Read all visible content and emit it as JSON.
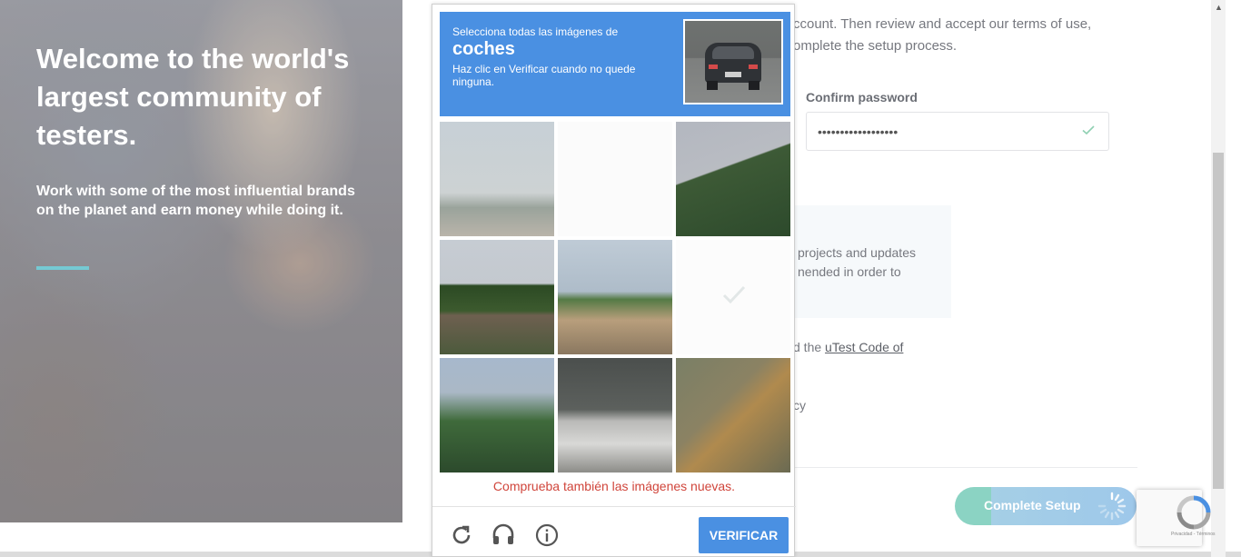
{
  "hero": {
    "title": "Welcome to the world's largest community of testers.",
    "subtitle": "Work with some of the most influential brands on the planet and earn money while doing it."
  },
  "form": {
    "intro_line1": "ccount. Then review and accept our terms of use,",
    "intro_line2": "omplete the setup process.",
    "confirm_password_label": "Confirm password",
    "confirm_password_value": "••••••••••••••••••",
    "info_line1": "projects and updates",
    "info_line2": "nended in order to",
    "terms_prefix": "d the ",
    "terms_link": "uTest Code of",
    "policy_fragment": "cy",
    "complete_setup_label": "Complete Setup"
  },
  "captcha": {
    "prompt_prefix": "Selecciona todas las imágenes de",
    "target": "coches",
    "instruction": "Haz clic en Verificar cuando no quede ninguna.",
    "error": "Comprueba también las imágenes nuevas.",
    "verify_label": "VERIFICAR",
    "tiles": [
      "sky-dunes",
      "blank",
      "hillside",
      "wires-house",
      "palms-house",
      "blank-selected",
      "trees",
      "cyclist-road",
      "tree-shadow"
    ]
  },
  "recaptcha_badge": {
    "terms": "Privacidad - Términos"
  },
  "icons": [
    "check-icon",
    "spinner-icon",
    "reload-icon",
    "headphones-icon",
    "info-icon",
    "recaptcha-logo-icon",
    "scroll-up-icon"
  ],
  "colors": {
    "captcha_blue": "#4a90e2",
    "error_red": "#d0453b",
    "accent_teal": "#75c9d3",
    "setup_green": "#8bd3c3",
    "setup_blue": "#9ec8ea"
  }
}
